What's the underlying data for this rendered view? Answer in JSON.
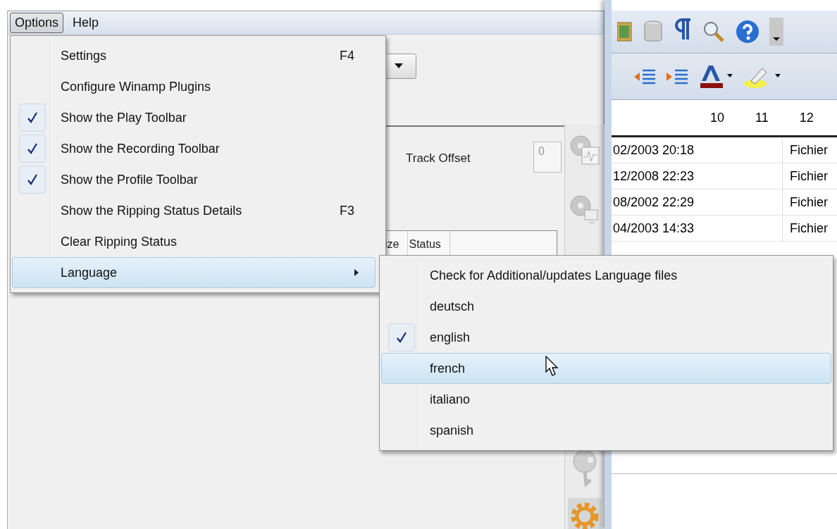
{
  "menu_bar": [
    {
      "label": "Options",
      "selected": true
    },
    {
      "label": "Help",
      "selected": false
    }
  ],
  "options_menu": {
    "items": [
      {
        "label": "Settings",
        "shortcut": "F4",
        "checked": false,
        "submenu": false,
        "selected": false
      },
      {
        "label": "Configure Winamp Plugins",
        "checked": false,
        "submenu": false,
        "selected": false
      },
      {
        "label": "Show the Play Toolbar",
        "checked": true,
        "submenu": false,
        "selected": false
      },
      {
        "label": "Show the Recording Toolbar",
        "checked": true,
        "submenu": false,
        "selected": false
      },
      {
        "label": "Show the Profile Toolbar",
        "checked": true,
        "submenu": false,
        "selected": false
      },
      {
        "label": "Show the Ripping Status Details",
        "shortcut": "F3",
        "checked": false,
        "submenu": false,
        "selected": false
      },
      {
        "label": "Clear Ripping Status",
        "checked": false,
        "submenu": false,
        "selected": false
      },
      {
        "label": "Language",
        "checked": false,
        "submenu": true,
        "selected": true
      }
    ]
  },
  "language_submenu": {
    "items": [
      {
        "label": "Check for Additional/updates Language files",
        "checked": false,
        "selected": false
      },
      {
        "label": "deutsch",
        "checked": false,
        "selected": false
      },
      {
        "label": "english",
        "checked": true,
        "selected": false
      },
      {
        "label": "french",
        "checked": false,
        "selected": true
      },
      {
        "label": "italiano",
        "checked": false,
        "selected": false
      },
      {
        "label": "spanish",
        "checked": false,
        "selected": false
      }
    ]
  },
  "ripper_window": {
    "track_offset_label": "Track Offset",
    "track_offset_value": "0",
    "columns": [
      "ize",
      "Status"
    ]
  },
  "editor_window": {
    "ruler_labels": [
      "10",
      "11",
      "12"
    ],
    "file_rows": [
      {
        "date": "02/2003 20:18",
        "type": "Fichier"
      },
      {
        "date": "12/2008 22:23",
        "type": "Fichier"
      },
      {
        "date": "08/2002 22:29",
        "type": "Fichier"
      },
      {
        "date": "04/2003 14:33",
        "type": "Fichier"
      }
    ]
  }
}
